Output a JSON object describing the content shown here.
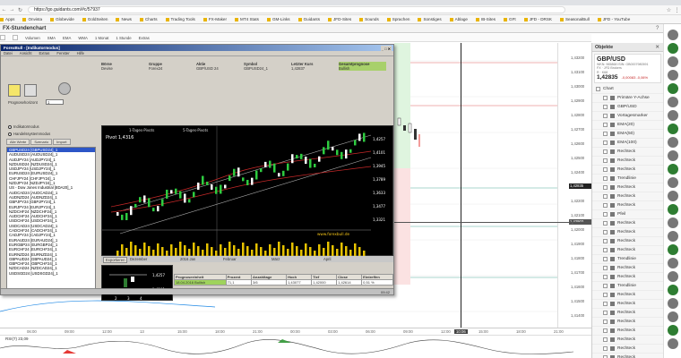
{
  "browser": {
    "url": "https://go.guidants.com/#c/57937",
    "bookmarks": [
      "Apps",
      "Onvista",
      "Globevide",
      "GoldSeiten",
      "News",
      "Charts",
      "Trading Tools",
      "FX-Maker",
      "MT4 Stats",
      "GM-Links",
      "Guidants",
      "JFD-Sites",
      "Sounds",
      "Sprachen",
      "Sonstiges",
      "Ablage",
      "IB-Sites",
      "GFt",
      "JFD - DRSK",
      "SeasonalBull",
      "JFD - YouTube"
    ]
  },
  "app": {
    "title": "FX-Stundenchart",
    "toolbar": [
      "Volumen",
      "SMA",
      "EMA",
      "WMA",
      "1 Monat",
      "1 Stunde",
      "Extras"
    ]
  },
  "axis": {
    "price_labels": [
      "1,43200",
      "1,43100",
      "1,43000",
      "1,42900",
      "1,42800",
      "1,42700",
      "1,42600",
      "1,42500",
      "1,42400",
      "1,42300",
      "1,42200",
      "1,42100",
      "1,42000",
      "1,41900",
      "1,41800",
      "1,41700",
      "1,41600",
      "1,41500",
      "1,41400"
    ],
    "price_current": "1,42835",
    "price_marker": "1,42903",
    "time_labels": [
      "06:00",
      "09:00",
      "12:00",
      "13",
      "15:00",
      "18:00",
      "21:00",
      "00:00",
      "03:00",
      "06:00",
      "09:00",
      "12:00",
      "15:00",
      "18:00",
      "21:00"
    ],
    "time_highlight": "10:06"
  },
  "rsi": {
    "label": "RSI(7) 23,09"
  },
  "objects_panel": {
    "title": "Objekte",
    "symbol": "GBP/USD",
    "meta_lines": [
      "WKN: 965868 ISIN: GB0007980591",
      "FX · JFD Brokers",
      "R · K68"
    ],
    "price": "1,42835",
    "change": "-0,00083 -0,06%",
    "items": [
      {
        "label": "Chart",
        "child": false
      },
      {
        "label": "Primäre Y-Achse",
        "child": true
      },
      {
        "label": "GBP/USD",
        "child": true
      },
      {
        "label": "Vortagesmarker",
        "child": true
      },
      {
        "label": "EMA(20)",
        "child": true
      },
      {
        "label": "EMA(50)",
        "child": true
      },
      {
        "label": "EMA(100)",
        "child": true
      },
      {
        "label": "Rechteck",
        "child": true
      },
      {
        "label": "Rechteck",
        "child": true
      },
      {
        "label": "Rechteck",
        "child": true
      },
      {
        "label": "Trendlinie",
        "child": true
      },
      {
        "label": "Rechteck",
        "child": true
      },
      {
        "label": "Rechteck",
        "child": true
      },
      {
        "label": "Rechteck",
        "child": true
      },
      {
        "label": "Pfeil",
        "child": true
      },
      {
        "label": "Rechteck",
        "child": true
      },
      {
        "label": "Rechteck",
        "child": true
      },
      {
        "label": "Rechteck",
        "child": true
      },
      {
        "label": "Rechteck",
        "child": true
      },
      {
        "label": "Trendlinie",
        "child": true
      },
      {
        "label": "Rechteck",
        "child": true
      },
      {
        "label": "Rechteck",
        "child": true
      },
      {
        "label": "Trendlinie",
        "child": true
      },
      {
        "label": "Rechteck",
        "child": true
      },
      {
        "label": "Rechteck",
        "child": true
      },
      {
        "label": "Rechteck",
        "child": true
      },
      {
        "label": "Rechteck",
        "child": true
      },
      {
        "label": "Rechteck",
        "child": true
      },
      {
        "label": "Rechteck",
        "child": true
      },
      {
        "label": "Rechteck",
        "child": true
      },
      {
        "label": "Rechteck",
        "child": true
      }
    ]
  },
  "legacy_window": {
    "title": "ForexBull - [Indikatormodus]",
    "menu": [
      "Datei",
      "Ansicht",
      "Extras",
      "Fenster",
      "Hilfe"
    ],
    "prognosis_label": "Prognosehorizont",
    "prognosis_value": "1",
    "radio_1": "Indikatormodus",
    "radio_2": "Handelssystemmodus",
    "subtabs": [
      "Alle Werte",
      "Szenario",
      "Import"
    ],
    "symbols": [
      "GBPUSD24 [GBPUSD24]_1",
      "AUDUSD24 [AUDUSD24]_1",
      "AUDJPY24 [AUDJPY24]_1",
      "NZDUSD24 [NZDUSD24]_1",
      "USDJPY24 [USDJPY24]_1",
      "EURUSD24 [EURUSD24]_1",
      "CHFJPY24 [CHFJPY24]_1",
      "NZDJPY24 [NZDJPY24]_1",
      "US - Dow Jones Industrial [8DA20]_1",
      "AUDCAD24 [AUDCAD24]_1",
      "AUDNZD24 [AUDNZD24]_1",
      "GBPJPY24 [GBPJPY24]_1",
      "EURJPY24 [EURJPY24]_1",
      "NZDCHF24 [NZDCHF24]_1",
      "AUDCHF24 [AUDCHF24]_1",
      "USDCHF24 [USDCHF24]_1",
      "USDCAD24 [USDCAD24]_1",
      "CADCHF24 [CADCHF24]_1",
      "CADJPY24 [CADJPY24]_1",
      "EURAUD24 [EURAUD24]_1",
      "EURGBP24 [EURGBP24]_1",
      "EURCHF24 [EURCHF24]_1",
      "EURNZD24 [EURNZD24]_1",
      "GBPAUD24 [GBPAUD24]_1",
      "GBPCHF24 [GBPCHF24]_1",
      "NZDCAD24 [NZDCAD24]_1",
      "USDSGD24 [USDSGD24]_1"
    ],
    "info_headers": [
      "Börse",
      "Gruppe",
      "Aktie",
      "Symbol",
      "Letzter Kurs",
      "Gesamtprognose"
    ],
    "info_values": [
      "Devise",
      "Forex24",
      "GBP/USD 24",
      "GBPUSD24_1",
      "1,42837",
      "Bullish"
    ],
    "chart_legend": [
      "1-Tages-Pivots",
      "5-Tages-Pivots"
    ],
    "pivot_label": "Pivot 1,4316",
    "chart_prices": [
      "1,4257",
      "1,4101",
      "1,3945",
      "1,3789",
      "1,3633",
      "1,3477",
      "1,3321"
    ],
    "watermark": "www.forexbull.de",
    "months": [
      "Dezember",
      "2016 Jan",
      "Februar",
      "März",
      "April"
    ],
    "export_btn": "Exportieren",
    "mini_prices": [
      "1,4257",
      "1,4101"
    ],
    "mini_x": [
      "2",
      "3",
      "4"
    ],
    "prog_headers": [
      "Prognoseeinheit",
      "Prozent",
      "Anzahltage",
      "Hoch",
      "Tief",
      "Close",
      "Eintreffen"
    ],
    "prog_row": [
      "18.04.2016 Bullish",
      "71,1",
      "3/6",
      "1,43077",
      "1,42000",
      "1,42614",
      "0,51 %"
    ],
    "status": "09:42"
  }
}
